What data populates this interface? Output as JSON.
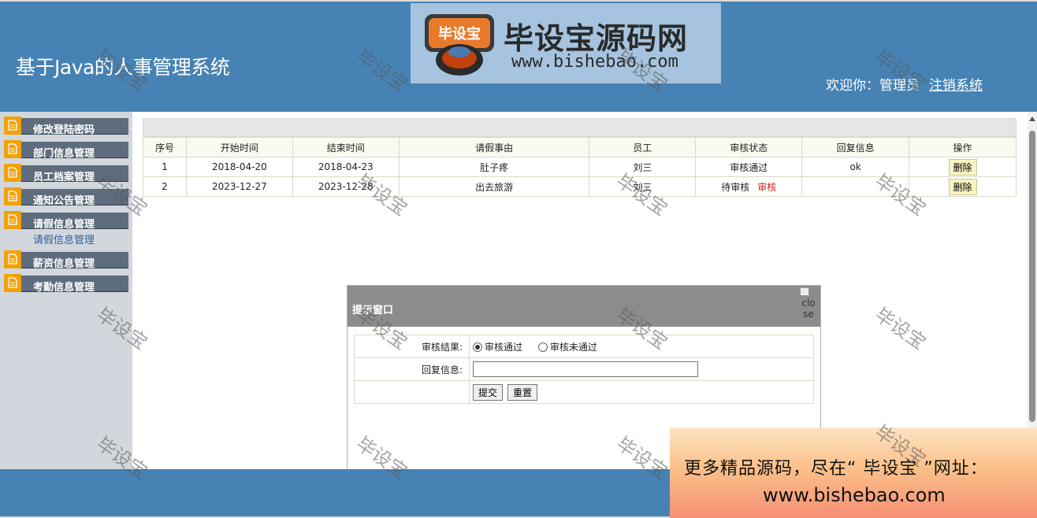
{
  "header": {
    "app_title": "基于Java的人事管理系统",
    "logo_text": "毕设宝源码网",
    "logo_badge_text": "毕设宝",
    "logo_url": "www.bishebao.com",
    "welcome_text": "欢迎你：管理员",
    "logout_label": "注销系统"
  },
  "sidebar": {
    "items": [
      {
        "label": "修改登陆密码",
        "icon": "document-icon"
      },
      {
        "label": "部门信息管理",
        "icon": "document-icon"
      },
      {
        "label": "员工档案管理",
        "icon": "document-icon"
      },
      {
        "label": "通知公告管理",
        "icon": "document-icon"
      },
      {
        "label": "请假信息管理",
        "icon": "document-icon"
      },
      {
        "label": "薪资信息管理",
        "icon": "document-icon"
      },
      {
        "label": "考勤信息管理",
        "icon": "document-icon"
      }
    ],
    "sub_item": "请假信息管理"
  },
  "table": {
    "headers": [
      "序号",
      "开始时间",
      "结束时间",
      "请假事由",
      "员工",
      "审核状态",
      "回复信息",
      "操作"
    ],
    "rows": [
      {
        "no": "1",
        "start": "2018-04-20",
        "end": "2018-04-23",
        "reason": "肚子疼",
        "employee": "刘三",
        "status": "审核通过",
        "audit_link": "",
        "reply": "ok",
        "action": "删除"
      },
      {
        "no": "2",
        "start": "2023-12-27",
        "end": "2023-12-28",
        "reason": "出去旅游",
        "employee": "刘三",
        "status": "待审核",
        "audit_link": "审核",
        "reply": "",
        "action": "删除"
      }
    ]
  },
  "modal": {
    "title": "提示窗口",
    "close_alt": "close",
    "result_label": "审核结果:",
    "option_pass": "审核通过",
    "option_fail": "审核未通过",
    "selected_option": "审核通过",
    "reply_label": "回复信息:",
    "reply_value": "",
    "submit_label": "提交",
    "reset_label": "重置"
  },
  "watermark_text": "毕设宝",
  "promo": {
    "line1": "更多精品源码，尽在“ 毕设宝 ”网址：",
    "line2": "www.bishebao.com"
  },
  "colors": {
    "header_bg": "#4682b4",
    "sidebar_bg": "#d2d7dd",
    "sidebar_item_bg": "#5d6d7d",
    "icon_accent": "#f1a20b",
    "audit_link": "#d22020",
    "modal_head_bg": "#8c8c8c"
  }
}
